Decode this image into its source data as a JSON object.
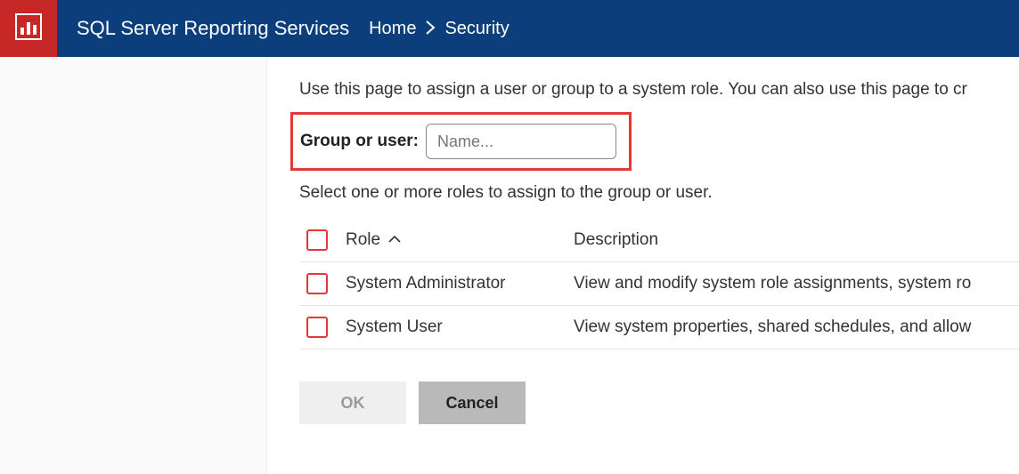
{
  "header": {
    "app_title": "SQL Server Reporting Services",
    "breadcrumb": {
      "home": "Home",
      "current": "Security"
    }
  },
  "main": {
    "intro_text": "Use this page to assign a user or group to a system role. You can also use this page to cr",
    "group_or_user": {
      "label": "Group or user:",
      "placeholder": "Name..."
    },
    "select_roles_text": "Select one or more roles to assign to the group or user.",
    "columns": {
      "role_header": "Role",
      "sort_indicator": "︿",
      "description_header": "Description"
    },
    "roles": [
      {
        "name": "System Administrator",
        "description": "View and modify system role assignments, system ro"
      },
      {
        "name": "System User",
        "description": "View system properties, shared schedules, and allow"
      }
    ],
    "buttons": {
      "ok": "OK",
      "cancel": "Cancel"
    }
  }
}
